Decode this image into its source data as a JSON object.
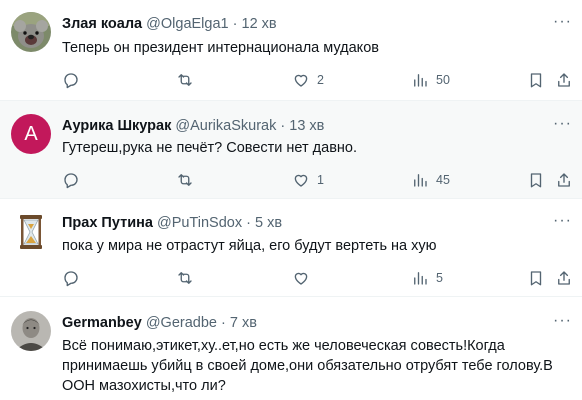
{
  "posts": [
    {
      "name": "Злая коала",
      "handle": "@OlgaElga1",
      "time": "12 хв",
      "text": "Теперь он президент интернационала мудаков",
      "replies": "",
      "reposts": "",
      "likes": "2",
      "views": "50",
      "highlighted": false
    },
    {
      "name": "Аурика Шкурак",
      "handle": "@AurikaSkurak",
      "time": "13 хв",
      "text": "Гутереш,рука не печёт? Совести нет давно.",
      "avatar_letter": "A",
      "replies": "",
      "reposts": "",
      "likes": "1",
      "views": "45",
      "highlighted": true
    },
    {
      "name": "Прах Путина",
      "handle": "@PuTinSdox",
      "time": "5 хв",
      "text": "пока у мира не отрастут яйца, его будут вертеть на хую",
      "replies": "",
      "reposts": "",
      "likes": "",
      "views": "5",
      "highlighted": false
    },
    {
      "name": "Germanbey",
      "handle": "@Geradbe",
      "time": "7 хв",
      "text": "Всё понимаю,этикет,ху..ет,но есть же человеческая совесть!Когда принимаешь убийц в своей доме,они обязательно отрубят тебе голову.В ООН мазохисты,что ли?",
      "highlighted": false
    }
  ],
  "ui": {
    "separator": "·",
    "more": "···"
  },
  "colors": {
    "text": "#0f1419",
    "secondary": "#536471",
    "divider": "#eff3f4",
    "highlight_bg": "#f7f9f9",
    "avatar_a_bg": "#c2185b"
  }
}
